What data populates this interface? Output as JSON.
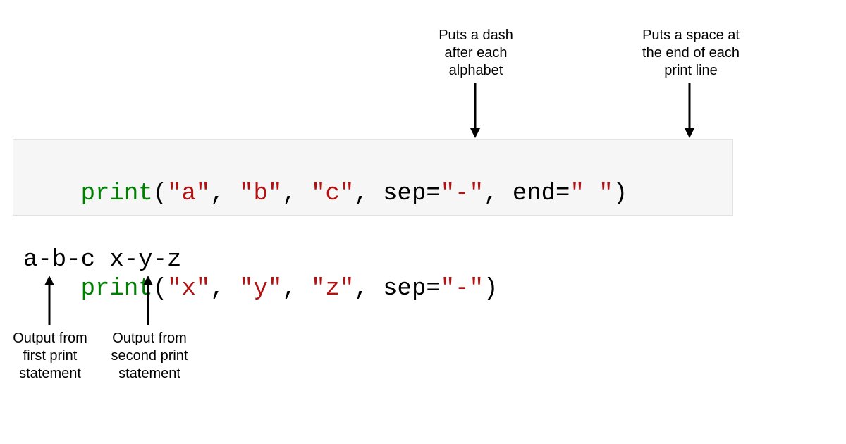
{
  "annotations": {
    "sep": "Puts a dash\nafter each\nalphabet",
    "end": "Puts a space at\nthe end of each\nprint line",
    "out1": "Output from\nfirst print\nstatement",
    "out2": "Output from\nsecond print\nstatement"
  },
  "code": {
    "line1": {
      "fn": "print",
      "open": "(",
      "a": "\"a\"",
      "c1": ", ",
      "b": "\"b\"",
      "c2": ", ",
      "c": "\"c\"",
      "c3": ", ",
      "sep_kw": "sep",
      "eq1": "=",
      "sep_val": "\"-\"",
      "c4": ", ",
      "end_kw": "end",
      "eq2": "=",
      "end_val": "\" \"",
      "close": ")"
    },
    "line2": {
      "fn": "print",
      "open": "(",
      "x": "\"x\"",
      "c1": ", ",
      "y": "\"y\"",
      "c2": ", ",
      "z": "\"z\"",
      "c3": ", ",
      "sep_kw": "sep",
      "eq1": "=",
      "sep_val": "\"-\"",
      "close": ")"
    }
  },
  "output": {
    "text": "a-b-c x-y-z"
  }
}
